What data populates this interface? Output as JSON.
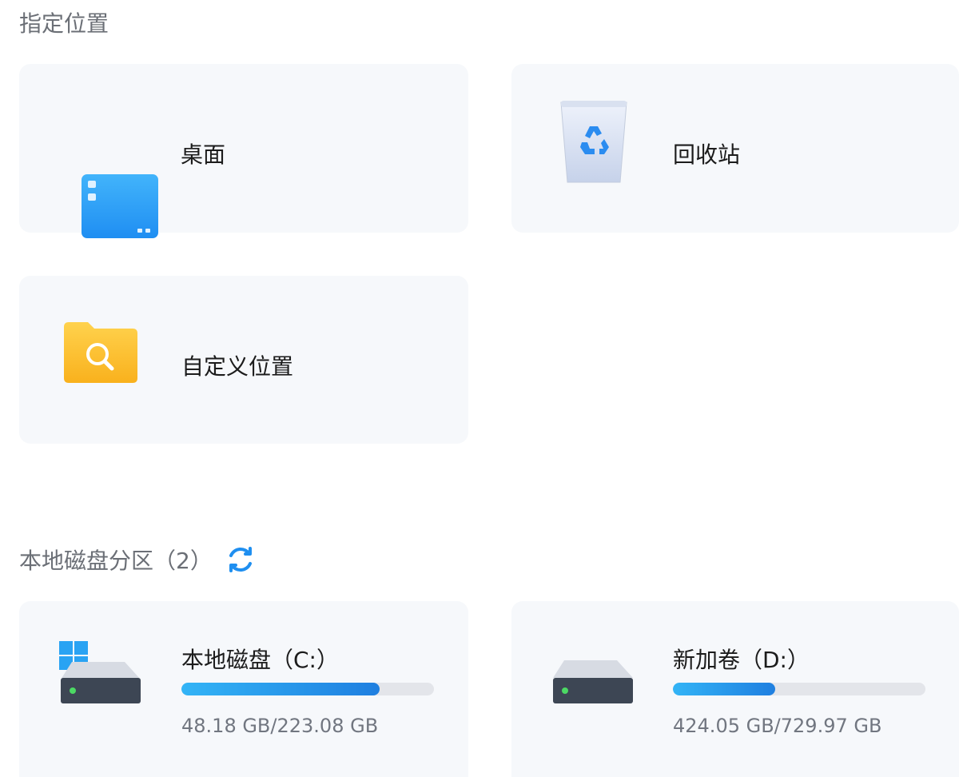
{
  "sections": {
    "locations_title": "指定位置",
    "partitions_title": "本地磁盘分区（2）"
  },
  "locations": {
    "desktop": {
      "label": "桌面",
      "icon": "desktop-icon"
    },
    "recycle_bin": {
      "label": "回收站",
      "icon": "recycle-bin-icon"
    },
    "custom": {
      "label": "自定义位置",
      "icon": "folder-search-icon"
    }
  },
  "drives": [
    {
      "label": "本地磁盘（C:）",
      "size_text": "48.18 GB/223.08 GB",
      "used_fraction": 0.785,
      "icon": "system-drive-icon"
    },
    {
      "label": "新加卷（D:）",
      "size_text": "424.05 GB/729.97 GB",
      "used_fraction": 0.405,
      "icon": "drive-icon"
    }
  ],
  "colors": {
    "accent": "#1f8ff0",
    "card_bg": "#f6f8fb",
    "bar_track": "#e3e5ea"
  }
}
